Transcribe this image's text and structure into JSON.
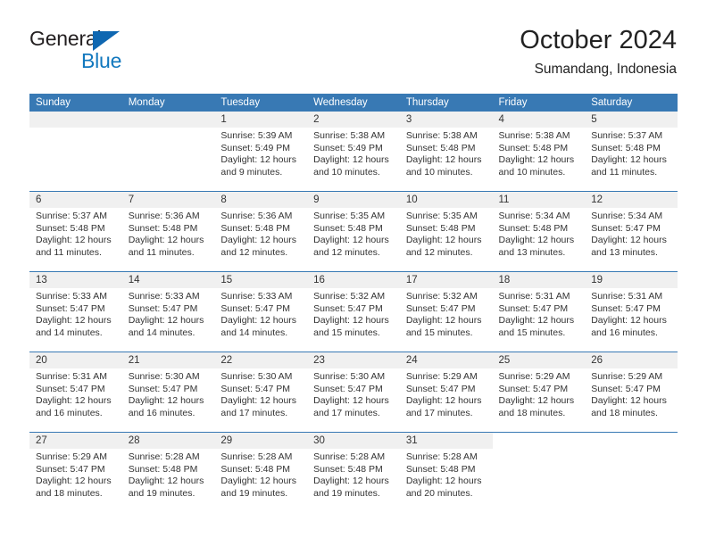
{
  "brand": {
    "line1": "General",
    "line2": "Blue",
    "triangle_icon": "blue-triangle-icon",
    "color_dark": "#231f20",
    "color_blue": "#1278be"
  },
  "header": {
    "title": "October 2024",
    "subtitle": "Sumandang, Indonesia"
  },
  "theme": {
    "header_blue": "#3879b4",
    "day_band_gray": "#f0f0f0",
    "text": "#333333"
  },
  "weekdays": [
    "Sunday",
    "Monday",
    "Tuesday",
    "Wednesday",
    "Thursday",
    "Friday",
    "Saturday"
  ],
  "weeks": [
    [
      {
        "day": "",
        "blank": true
      },
      {
        "day": "",
        "blank": true
      },
      {
        "day": "1",
        "sunrise": "Sunrise: 5:39 AM",
        "sunset": "Sunset: 5:49 PM",
        "daylight1": "Daylight: 12 hours",
        "daylight2": "and 9 minutes."
      },
      {
        "day": "2",
        "sunrise": "Sunrise: 5:38 AM",
        "sunset": "Sunset: 5:49 PM",
        "daylight1": "Daylight: 12 hours",
        "daylight2": "and 10 minutes."
      },
      {
        "day": "3",
        "sunrise": "Sunrise: 5:38 AM",
        "sunset": "Sunset: 5:48 PM",
        "daylight1": "Daylight: 12 hours",
        "daylight2": "and 10 minutes."
      },
      {
        "day": "4",
        "sunrise": "Sunrise: 5:38 AM",
        "sunset": "Sunset: 5:48 PM",
        "daylight1": "Daylight: 12 hours",
        "daylight2": "and 10 minutes."
      },
      {
        "day": "5",
        "sunrise": "Sunrise: 5:37 AM",
        "sunset": "Sunset: 5:48 PM",
        "daylight1": "Daylight: 12 hours",
        "daylight2": "and 11 minutes."
      }
    ],
    [
      {
        "day": "6",
        "sunrise": "Sunrise: 5:37 AM",
        "sunset": "Sunset: 5:48 PM",
        "daylight1": "Daylight: 12 hours",
        "daylight2": "and 11 minutes."
      },
      {
        "day": "7",
        "sunrise": "Sunrise: 5:36 AM",
        "sunset": "Sunset: 5:48 PM",
        "daylight1": "Daylight: 12 hours",
        "daylight2": "and 11 minutes."
      },
      {
        "day": "8",
        "sunrise": "Sunrise: 5:36 AM",
        "sunset": "Sunset: 5:48 PM",
        "daylight1": "Daylight: 12 hours",
        "daylight2": "and 12 minutes."
      },
      {
        "day": "9",
        "sunrise": "Sunrise: 5:35 AM",
        "sunset": "Sunset: 5:48 PM",
        "daylight1": "Daylight: 12 hours",
        "daylight2": "and 12 minutes."
      },
      {
        "day": "10",
        "sunrise": "Sunrise: 5:35 AM",
        "sunset": "Sunset: 5:48 PM",
        "daylight1": "Daylight: 12 hours",
        "daylight2": "and 12 minutes."
      },
      {
        "day": "11",
        "sunrise": "Sunrise: 5:34 AM",
        "sunset": "Sunset: 5:48 PM",
        "daylight1": "Daylight: 12 hours",
        "daylight2": "and 13 minutes."
      },
      {
        "day": "12",
        "sunrise": "Sunrise: 5:34 AM",
        "sunset": "Sunset: 5:47 PM",
        "daylight1": "Daylight: 12 hours",
        "daylight2": "and 13 minutes."
      }
    ],
    [
      {
        "day": "13",
        "sunrise": "Sunrise: 5:33 AM",
        "sunset": "Sunset: 5:47 PM",
        "daylight1": "Daylight: 12 hours",
        "daylight2": "and 14 minutes."
      },
      {
        "day": "14",
        "sunrise": "Sunrise: 5:33 AM",
        "sunset": "Sunset: 5:47 PM",
        "daylight1": "Daylight: 12 hours",
        "daylight2": "and 14 minutes."
      },
      {
        "day": "15",
        "sunrise": "Sunrise: 5:33 AM",
        "sunset": "Sunset: 5:47 PM",
        "daylight1": "Daylight: 12 hours",
        "daylight2": "and 14 minutes."
      },
      {
        "day": "16",
        "sunrise": "Sunrise: 5:32 AM",
        "sunset": "Sunset: 5:47 PM",
        "daylight1": "Daylight: 12 hours",
        "daylight2": "and 15 minutes."
      },
      {
        "day": "17",
        "sunrise": "Sunrise: 5:32 AM",
        "sunset": "Sunset: 5:47 PM",
        "daylight1": "Daylight: 12 hours",
        "daylight2": "and 15 minutes."
      },
      {
        "day": "18",
        "sunrise": "Sunrise: 5:31 AM",
        "sunset": "Sunset: 5:47 PM",
        "daylight1": "Daylight: 12 hours",
        "daylight2": "and 15 minutes."
      },
      {
        "day": "19",
        "sunrise": "Sunrise: 5:31 AM",
        "sunset": "Sunset: 5:47 PM",
        "daylight1": "Daylight: 12 hours",
        "daylight2": "and 16 minutes."
      }
    ],
    [
      {
        "day": "20",
        "sunrise": "Sunrise: 5:31 AM",
        "sunset": "Sunset: 5:47 PM",
        "daylight1": "Daylight: 12 hours",
        "daylight2": "and 16 minutes."
      },
      {
        "day": "21",
        "sunrise": "Sunrise: 5:30 AM",
        "sunset": "Sunset: 5:47 PM",
        "daylight1": "Daylight: 12 hours",
        "daylight2": "and 16 minutes."
      },
      {
        "day": "22",
        "sunrise": "Sunrise: 5:30 AM",
        "sunset": "Sunset: 5:47 PM",
        "daylight1": "Daylight: 12 hours",
        "daylight2": "and 17 minutes."
      },
      {
        "day": "23",
        "sunrise": "Sunrise: 5:30 AM",
        "sunset": "Sunset: 5:47 PM",
        "daylight1": "Daylight: 12 hours",
        "daylight2": "and 17 minutes."
      },
      {
        "day": "24",
        "sunrise": "Sunrise: 5:29 AM",
        "sunset": "Sunset: 5:47 PM",
        "daylight1": "Daylight: 12 hours",
        "daylight2": "and 17 minutes."
      },
      {
        "day": "25",
        "sunrise": "Sunrise: 5:29 AM",
        "sunset": "Sunset: 5:47 PM",
        "daylight1": "Daylight: 12 hours",
        "daylight2": "and 18 minutes."
      },
      {
        "day": "26",
        "sunrise": "Sunrise: 5:29 AM",
        "sunset": "Sunset: 5:47 PM",
        "daylight1": "Daylight: 12 hours",
        "daylight2": "and 18 minutes."
      }
    ],
    [
      {
        "day": "27",
        "sunrise": "Sunrise: 5:29 AM",
        "sunset": "Sunset: 5:47 PM",
        "daylight1": "Daylight: 12 hours",
        "daylight2": "and 18 minutes."
      },
      {
        "day": "28",
        "sunrise": "Sunrise: 5:28 AM",
        "sunset": "Sunset: 5:48 PM",
        "daylight1": "Daylight: 12 hours",
        "daylight2": "and 19 minutes."
      },
      {
        "day": "29",
        "sunrise": "Sunrise: 5:28 AM",
        "sunset": "Sunset: 5:48 PM",
        "daylight1": "Daylight: 12 hours",
        "daylight2": "and 19 minutes."
      },
      {
        "day": "30",
        "sunrise": "Sunrise: 5:28 AM",
        "sunset": "Sunset: 5:48 PM",
        "daylight1": "Daylight: 12 hours",
        "daylight2": "and 19 minutes."
      },
      {
        "day": "31",
        "sunrise": "Sunrise: 5:28 AM",
        "sunset": "Sunset: 5:48 PM",
        "daylight1": "Daylight: 12 hours",
        "daylight2": "and 20 minutes."
      },
      {
        "day": "",
        "blank": true,
        "noband": true
      },
      {
        "day": "",
        "blank": true,
        "noband": true
      }
    ]
  ]
}
